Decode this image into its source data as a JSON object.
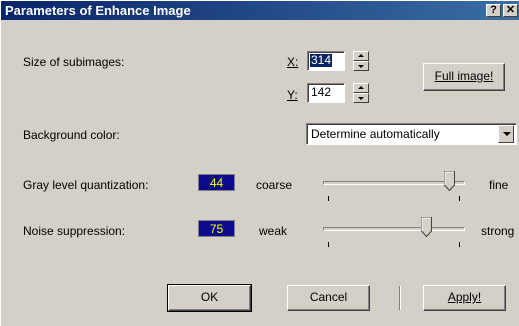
{
  "window": {
    "title": "Parameters of Enhance Image",
    "help_glyph": "?",
    "close_glyph": "✕"
  },
  "subimages": {
    "label": "Size of subimages:",
    "x_label": "X:",
    "x_value": "314",
    "y_label": "Y:",
    "y_value": "142",
    "full_image_label": "Full image!"
  },
  "background": {
    "label": "Background color:",
    "selected": "Determine automatically"
  },
  "gray": {
    "label": "Gray level quantization:",
    "value": "44",
    "left": "coarse",
    "right": "fine",
    "level": 0.84
  },
  "noise": {
    "label": "Noise suppression:",
    "value": "75",
    "left": "weak",
    "right": "strong",
    "level": 0.75
  },
  "buttons": {
    "ok": "OK",
    "cancel": "Cancel",
    "apply": "Apply!"
  },
  "colors": {
    "titlebar": "#0a246a",
    "value_bg": "#0a0a8a",
    "value_fg": "#ffff00",
    "face": "#d4d0c8"
  }
}
